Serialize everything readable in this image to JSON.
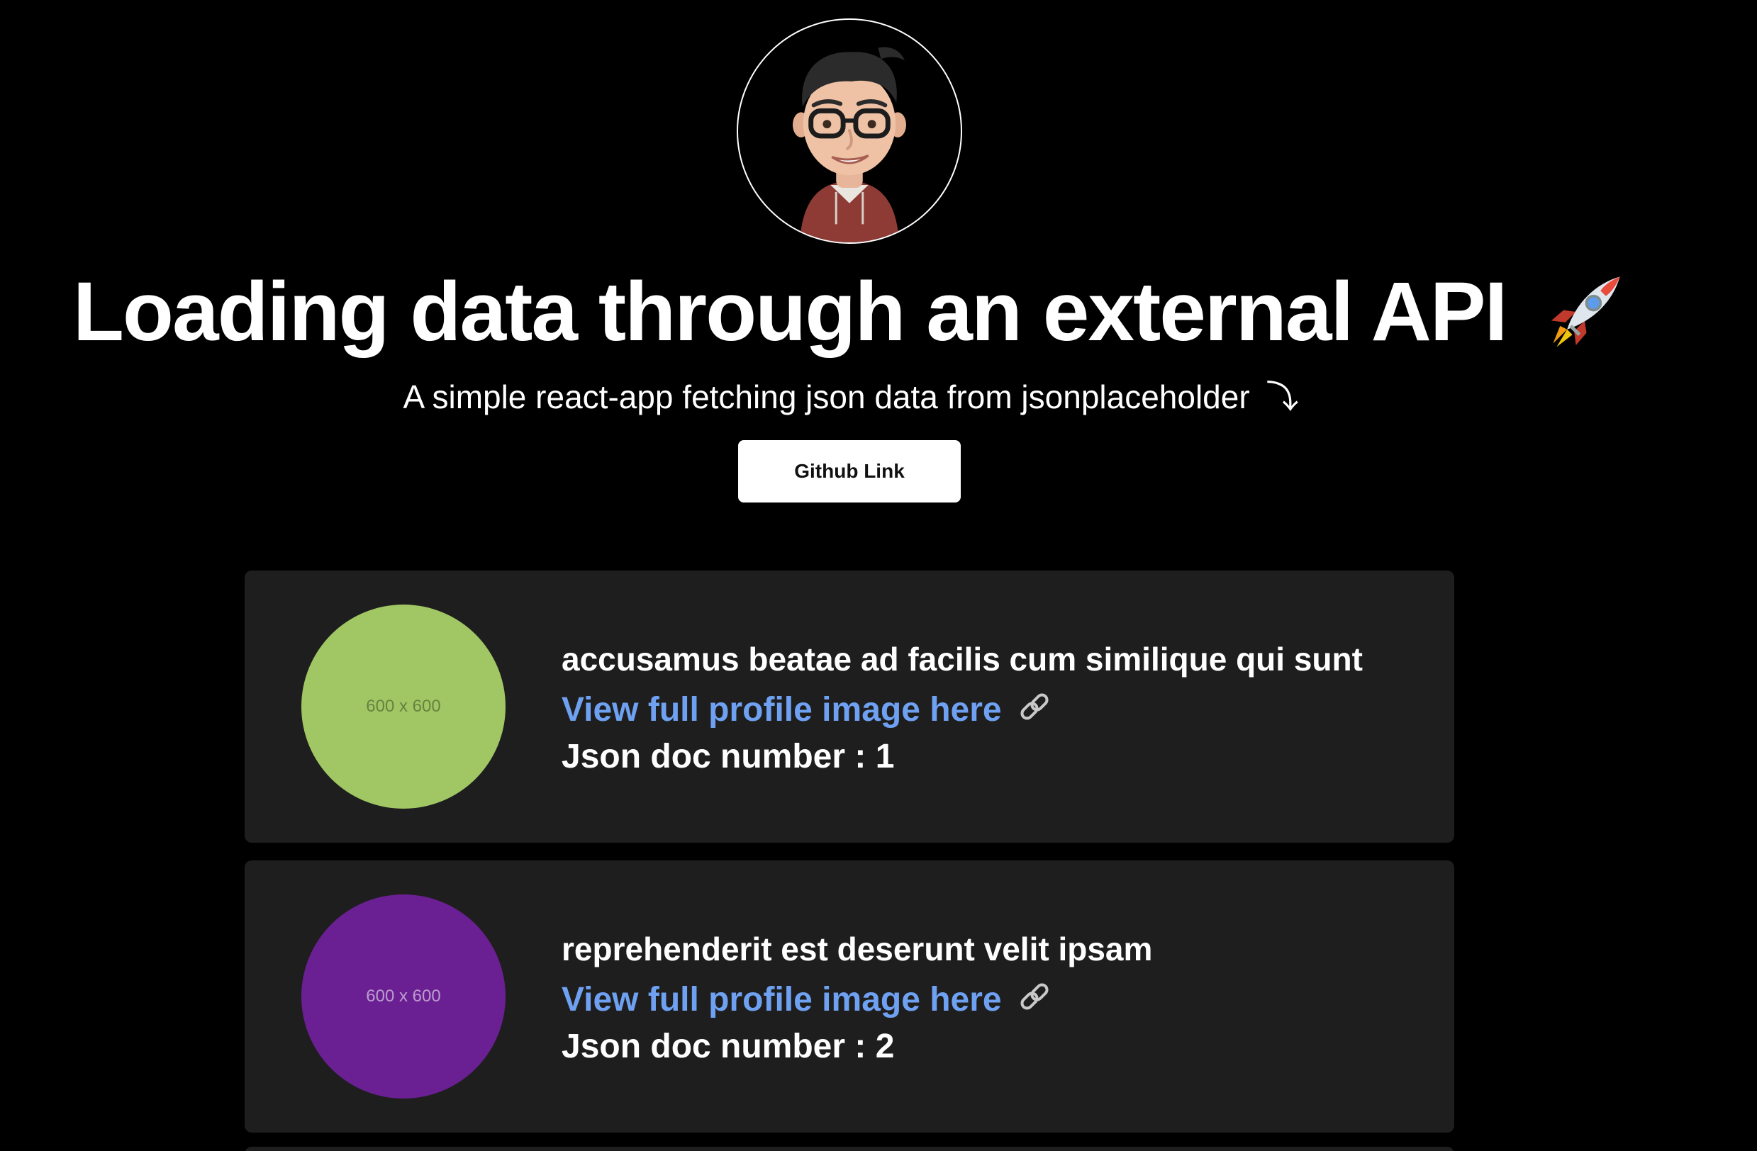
{
  "header": {
    "avatar_icon": "memoji-avatar-icon",
    "title": "Loading data through an external API",
    "title_icon": "rocket-icon",
    "subtitle": "A simple react-app fetching json data from jsonplaceholder",
    "subtitle_arrow": "⤵",
    "github_button_label": "Github Link"
  },
  "cards": [
    {
      "thumb_label": "600 x 600",
      "thumb_color": "#a0c764",
      "title": "accusamus beatae ad facilis cum similique qui sunt",
      "link_label": "View full profile image here",
      "doc_number": "Json doc number : 1"
    },
    {
      "thumb_label": "600 x 600",
      "thumb_color": "#6a2092",
      "title": "reprehenderit est deserunt velit ipsam",
      "link_label": "View full profile image here",
      "doc_number": "Json doc number : 2"
    }
  ],
  "colors": {
    "background": "#000000",
    "card_background": "#1e1e1e",
    "link": "#6fa1f2",
    "button_background": "#ffffff"
  }
}
